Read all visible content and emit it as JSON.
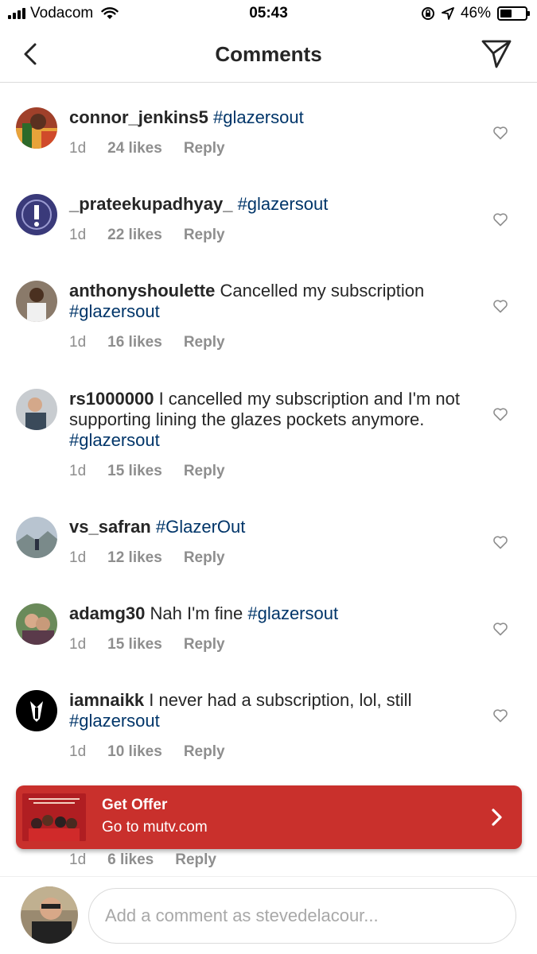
{
  "status_bar": {
    "carrier": "Vodacom",
    "time": "05:43",
    "battery": "46%",
    "battery_level": 0.46
  },
  "header": {
    "title": "Comments"
  },
  "comments": [
    {
      "username": "connor_jenkins5",
      "text": "",
      "hashtag": "#glazersout",
      "time": "1d",
      "likes": "24 likes",
      "reply": "Reply"
    },
    {
      "username": "_prateekupadhyay_",
      "text": "",
      "hashtag": "#glazersout",
      "time": "1d",
      "likes": "22 likes",
      "reply": "Reply"
    },
    {
      "username": "anthonyshoulette",
      "text": "Cancelled my subscription",
      "hashtag": "#glazersout",
      "time": "1d",
      "likes": "16 likes",
      "reply": "Reply"
    },
    {
      "username": "rs1000000",
      "text": "I cancelled my subscription and I'm not supporting lining the glazes pockets anymore.",
      "hashtag": "#glazersout",
      "time": "1d",
      "likes": "15 likes",
      "reply": "Reply"
    },
    {
      "username": "vs_safran",
      "text": "",
      "hashtag": "#GlazerOut",
      "time": "1d",
      "likes": "12 likes",
      "reply": "Reply"
    },
    {
      "username": "adamg30",
      "text": "Nah I'm fine",
      "hashtag": "#glazersout",
      "time": "1d",
      "likes": "15 likes",
      "reply": "Reply"
    },
    {
      "username": "iamnaikk",
      "text": "I never had a subscription, lol, still",
      "hashtag": "#glazersout",
      "time": "1d",
      "likes": "10 likes",
      "reply": "Reply"
    },
    {
      "username": "",
      "text": "",
      "hashtag": "",
      "time": "1d",
      "likes": "6 likes",
      "reply": "Reply"
    }
  ],
  "offer": {
    "title": "Get Offer",
    "subtitle": "Go to mutv.com",
    "color": "#c9302c"
  },
  "comment_input": {
    "placeholder": "Add a comment as stevedelacour..."
  },
  "colors": {
    "hashtag": "#003569",
    "meta": "#8e8e8e",
    "text": "#262626"
  }
}
